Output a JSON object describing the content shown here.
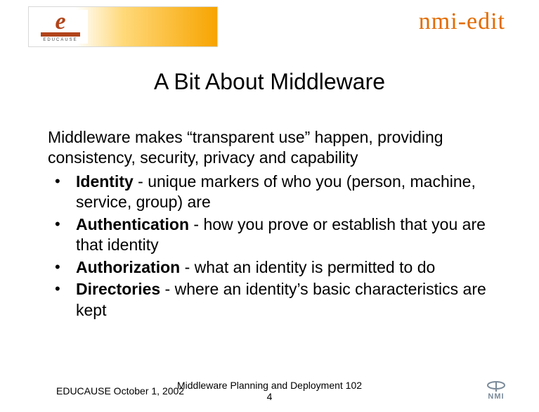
{
  "header": {
    "educause_letter": "e",
    "educause_caption": "EDUCAUSE",
    "brand_right": "nmi-edit"
  },
  "title": "A Bit About Middleware",
  "intro": "Middleware makes “transparent use” happen, providing consistency, security, privacy and capability",
  "bullets": [
    {
      "term": "Identity",
      "desc": " - unique markers of who you (person, machine, service, group) are"
    },
    {
      "term": "Authentication",
      "desc": " - how you prove or establish that you are that  identity"
    },
    {
      "term": "Authorization",
      "desc": " - what an identity is permitted to do"
    },
    {
      "term": "Directories",
      "desc": " - where an identity’s basic characteristics are kept"
    }
  ],
  "footer": {
    "left": "EDUCAUSE October 1, 2002",
    "center_line1": "Middleware Planning and Deployment 102",
    "center_line2": "4",
    "nmi_label": "NMI"
  }
}
